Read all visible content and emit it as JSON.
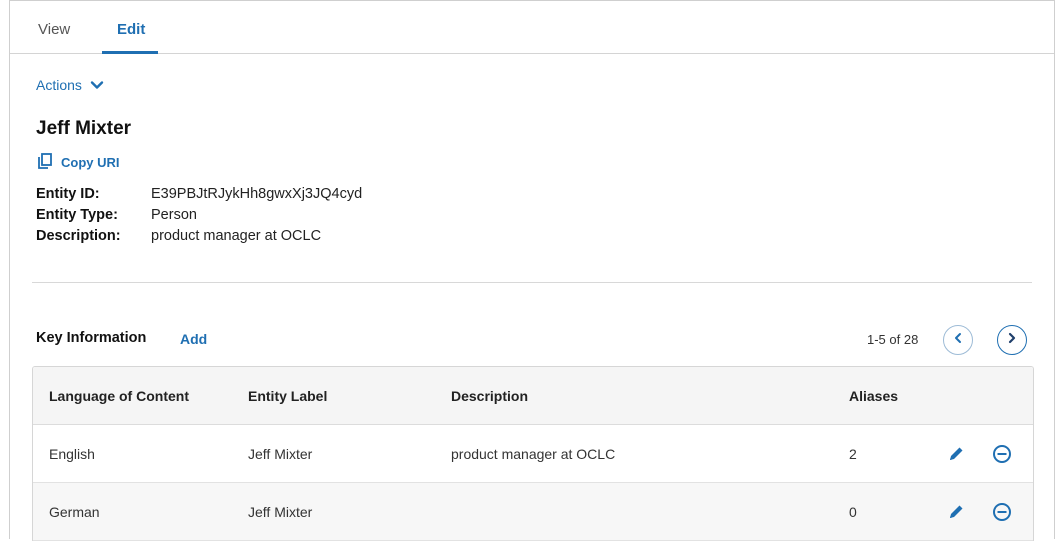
{
  "tabs": [
    {
      "label": "View"
    },
    {
      "label": "Edit"
    }
  ],
  "actions": {
    "label": "Actions"
  },
  "entity": {
    "name": "Jeff Mixter",
    "copy_uri_label": "Copy URI",
    "fields": [
      {
        "label": "Entity ID:",
        "value": "E39PBJtRJykHh8gwxXj3JQ4cyd"
      },
      {
        "label": "Entity Type:",
        "value": "Person"
      },
      {
        "label": "Description:",
        "value": "product manager at OCLC"
      }
    ]
  },
  "key_info": {
    "title": "Key Information",
    "add_label": "Add",
    "pager": "1-5 of 28",
    "columns": [
      "Language of Content",
      "Entity Label",
      "Description",
      "Aliases"
    ],
    "rows": [
      {
        "language": "English",
        "label": "Jeff Mixter",
        "description": "product manager at OCLC",
        "aliases": "2"
      },
      {
        "language": "German",
        "label": "Jeff Mixter",
        "description": "",
        "aliases": "0"
      }
    ]
  },
  "colors": {
    "accent": "#1f6fb2",
    "header_bg": "#f5f5f5"
  }
}
